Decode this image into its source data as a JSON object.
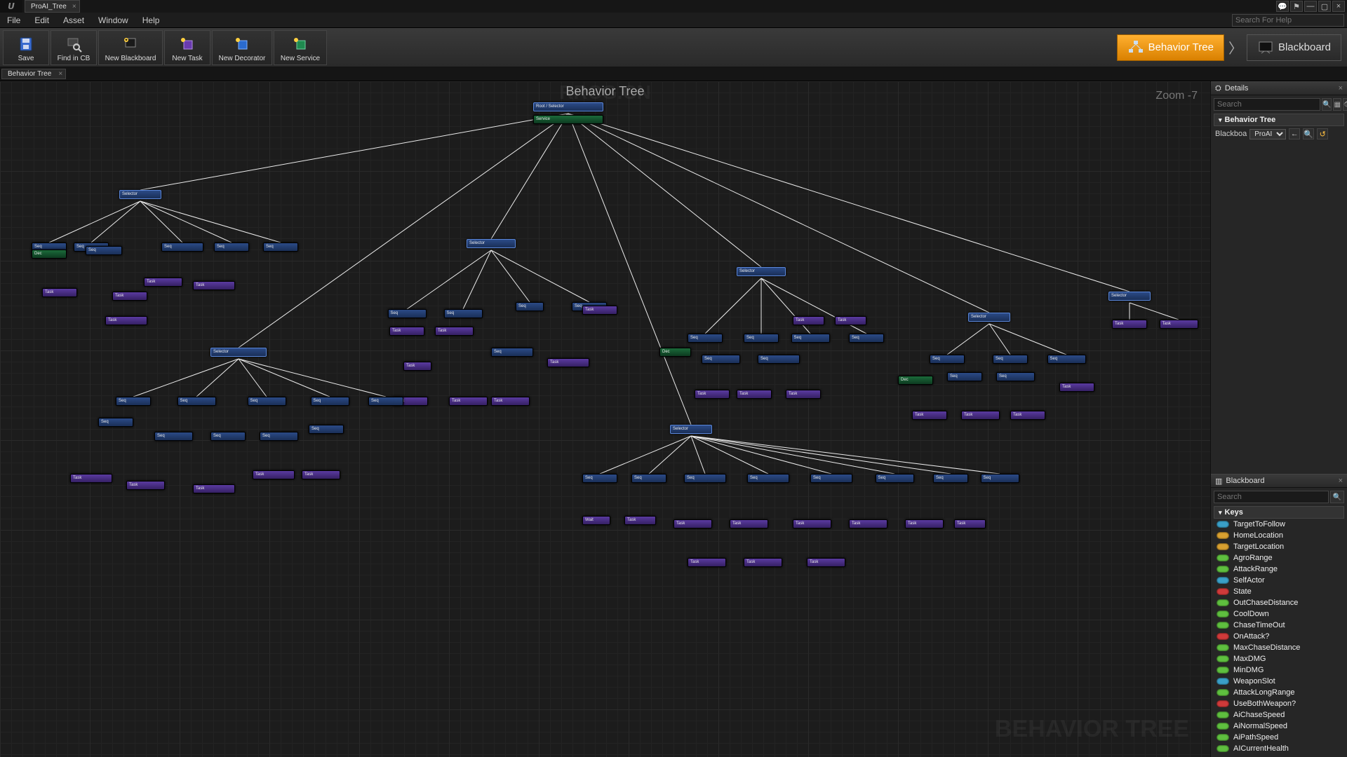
{
  "window": {
    "tab_title": "ProAI_Tree"
  },
  "menus": [
    "File",
    "Edit",
    "Asset",
    "Window",
    "Help"
  ],
  "help_placeholder": "Search For Help",
  "toolbar": {
    "save": "Save",
    "find": "Find in CB",
    "newbb": "New Blackboard",
    "newtask": "New Task",
    "newdecorator": "New Decorator",
    "newservice": "New Service"
  },
  "mode": {
    "bt": "Behavior Tree",
    "bb": "Blackboard"
  },
  "subtab": "Behavior Tree",
  "graph": {
    "title": "Behavior Tree",
    "zoom": "Zoom -7",
    "root_label": "Root / Selector"
  },
  "details": {
    "panel": "Details",
    "search_placeholder": "Search",
    "section": "Behavior Tree",
    "prop_label": "Blackboa",
    "prop_value": "ProAI"
  },
  "blackboard": {
    "panel": "Blackboard",
    "search_placeholder": "Search",
    "section": "Keys",
    "keys": [
      {
        "name": "TargetToFollow",
        "c": "#3aa0c8"
      },
      {
        "name": "HomeLocation",
        "c": "#d8a030"
      },
      {
        "name": "TargetLocation",
        "c": "#d8a030"
      },
      {
        "name": "AgroRange",
        "c": "#5fbf3f"
      },
      {
        "name": "AttackRange",
        "c": "#5fbf3f"
      },
      {
        "name": "SelfActor",
        "c": "#3aa0c8"
      },
      {
        "name": "State",
        "c": "#d03a3a"
      },
      {
        "name": "OutChaseDistance",
        "c": "#5fbf3f"
      },
      {
        "name": "CoolDown",
        "c": "#5fbf3f"
      },
      {
        "name": "ChaseTimeOut",
        "c": "#5fbf3f"
      },
      {
        "name": "OnAttack?",
        "c": "#d03a3a"
      },
      {
        "name": "MaxChaseDistance",
        "c": "#5fbf3f"
      },
      {
        "name": "MaxDMG",
        "c": "#5fbf3f"
      },
      {
        "name": "MinDMG",
        "c": "#5fbf3f"
      },
      {
        "name": "WeaponSlot",
        "c": "#3aa0c8"
      },
      {
        "name": "AttackLongRange",
        "c": "#5fbf3f"
      },
      {
        "name": "UseBothWeapon?",
        "c": "#d03a3a"
      },
      {
        "name": "AiChaseSpeed",
        "c": "#5fbf3f"
      },
      {
        "name": "AiNormalSpeed",
        "c": "#5fbf3f"
      },
      {
        "name": "AiPathSpeed",
        "c": "#5fbf3f"
      },
      {
        "name": "AICurrentHealth",
        "c": "#5fbf3f"
      }
    ]
  },
  "watermarks": {
    "top": "RRCG.CN",
    "bottom": "BEHAVIOR TREE"
  }
}
